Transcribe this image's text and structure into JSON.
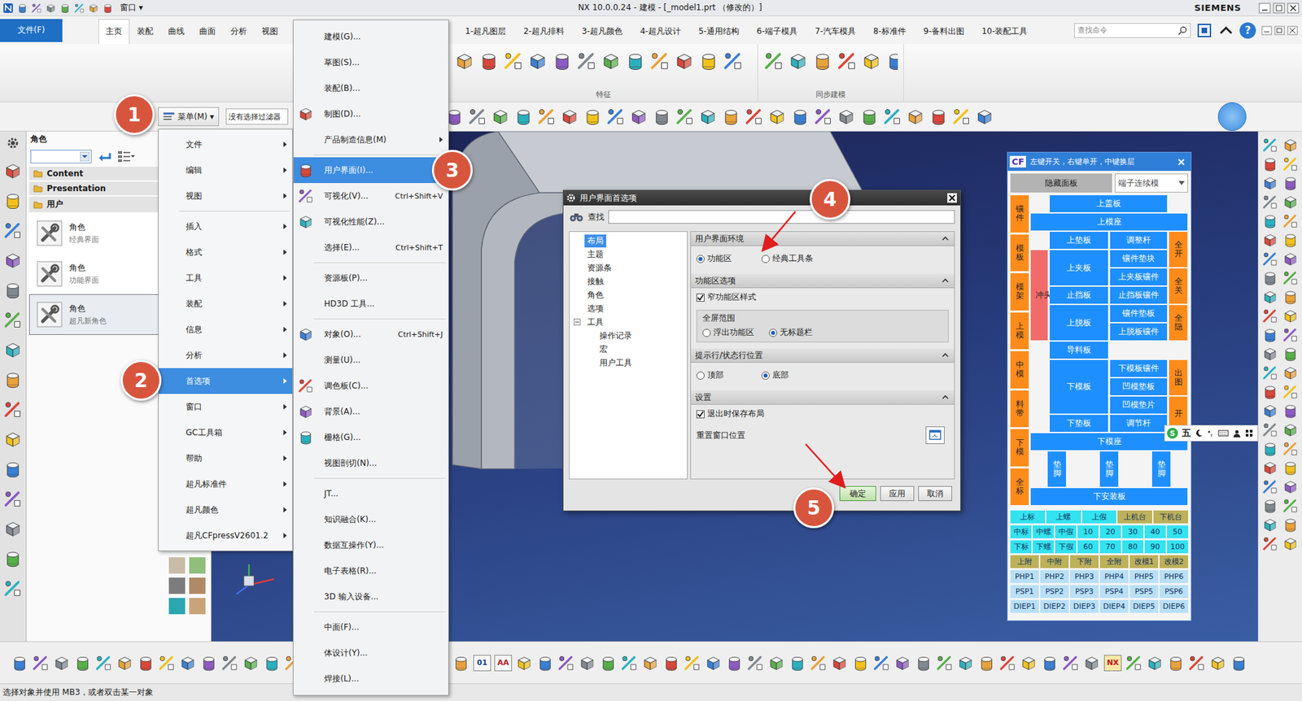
{
  "window": {
    "title": "NX 10.0.0.24 - 建模 - [_model1.prt （修改的）]",
    "brand": "SIEMENS",
    "window_menu": "窗口 ▾"
  },
  "ribbon": {
    "file_tab": "文件(F)",
    "tabs": [
      {
        "label": "主页",
        "selected": true
      },
      {
        "label": "装配",
        "selected": false
      },
      {
        "label": "曲线",
        "selected": false
      },
      {
        "label": "曲面",
        "selected": false
      },
      {
        "label": "分析",
        "selected": false
      },
      {
        "label": "视图",
        "selected": false
      }
    ],
    "custom_tabs": [
      {
        "label": "1-超凡图层",
        "selected": false
      },
      {
        "label": "2-超凡排料",
        "selected": false
      },
      {
        "label": "3-超凡颜色",
        "selected": false
      },
      {
        "label": "4-超凡设计",
        "selected": false
      },
      {
        "label": "5-通用结构",
        "selected": false
      },
      {
        "label": "6-端子模具",
        "selected": false
      },
      {
        "label": "7-汽车模具",
        "selected": false
      },
      {
        "label": "8-标准件",
        "selected": false
      },
      {
        "label": "9-备料出图",
        "selected": false
      },
      {
        "label": "10-装配工具",
        "selected": false
      }
    ],
    "search_placeholder": "查找命令",
    "help": "?",
    "groups": [
      "特征",
      "同步建模"
    ]
  },
  "toolbar": {
    "menu_button": "菜单(M) ▾",
    "selection_filter": "没有选择过滤器"
  },
  "resource_panel": {
    "title": "角色",
    "folders": [
      "Content",
      "Presentation",
      "用户"
    ],
    "roles": [
      {
        "name": "角色",
        "desc": "经典界面",
        "selected": false
      },
      {
        "name": "角色",
        "desc": "功能界面",
        "selected": false
      },
      {
        "name": "角色",
        "desc": "超凡新角色",
        "selected": true
      }
    ]
  },
  "main_menu": {
    "groups": [
      [
        {
          "label": "文件",
          "submenu": true,
          "selected": false
        },
        {
          "label": "编辑",
          "submenu": true,
          "selected": false
        },
        {
          "label": "视图",
          "submenu": true,
          "selected": false
        }
      ],
      [
        {
          "label": "插入",
          "submenu": true,
          "selected": false
        },
        {
          "label": "格式",
          "submenu": true,
          "selected": false
        },
        {
          "label": "工具",
          "submenu": true,
          "selected": false
        },
        {
          "label": "装配",
          "submenu": true,
          "selected": false
        },
        {
          "label": "信息",
          "submenu": true,
          "selected": false
        },
        {
          "label": "分析",
          "submenu": true,
          "selected": false
        },
        {
          "label": "首选项",
          "submenu": true,
          "selected": true
        },
        {
          "label": "窗口",
          "submenu": true,
          "selected": false
        },
        {
          "label": "GC工具箱",
          "submenu": true,
          "selected": false
        },
        {
          "label": "帮助",
          "submenu": true,
          "selected": false
        },
        {
          "label": "超凡标准件",
          "submenu": true,
          "selected": false
        },
        {
          "label": "超凡颜色",
          "submenu": true,
          "selected": false
        },
        {
          "label": "超凡CFpressV2601.2",
          "submenu": true,
          "selected": false
        }
      ]
    ]
  },
  "preferences_menu": {
    "groups": [
      [
        {
          "label": "建模(G)...",
          "shortcut": "",
          "icon": false,
          "submenu": false,
          "selected": false
        },
        {
          "label": "草图(S)...",
          "shortcut": "",
          "icon": false,
          "submenu": false,
          "selected": false
        },
        {
          "label": "装配(B)...",
          "shortcut": "",
          "icon": false,
          "submenu": false,
          "selected": false
        },
        {
          "label": "制图(D)...",
          "shortcut": "",
          "icon": true,
          "submenu": false,
          "selected": false
        },
        {
          "label": "产品制造信息(M)",
          "shortcut": "",
          "icon": false,
          "submenu": true,
          "selected": false
        }
      ],
      [
        {
          "label": "用户界面(I)...",
          "shortcut": "",
          "icon": true,
          "submenu": false,
          "selected": true
        },
        {
          "label": "可视化(V)...",
          "shortcut": "Ctrl+Shift+V",
          "icon": true,
          "submenu": false,
          "selected": false
        },
        {
          "label": "可视化性能(Z)...",
          "shortcut": "",
          "icon": true,
          "submenu": false,
          "selected": false
        },
        {
          "label": "选择(E)...",
          "shortcut": "Ctrl+Shift+T",
          "icon": false,
          "submenu": false,
          "selected": false
        }
      ],
      [
        {
          "label": "资源板(P)...",
          "shortcut": "",
          "icon": false,
          "submenu": false,
          "selected": false
        },
        {
          "label": "HD3D 工具...",
          "shortcut": "",
          "icon": false,
          "submenu": false,
          "selected": false
        }
      ],
      [
        {
          "label": "对象(O)...",
          "shortcut": "Ctrl+Shift+J",
          "icon": true,
          "submenu": false,
          "selected": false
        },
        {
          "label": "测量(U)...",
          "shortcut": "",
          "icon": false,
          "submenu": false,
          "selected": false
        },
        {
          "label": "调色板(C)...",
          "shortcut": "",
          "icon": true,
          "submenu": false,
          "selected": false
        },
        {
          "label": "背景(A)...",
          "shortcut": "",
          "icon": true,
          "submenu": false,
          "selected": false
        },
        {
          "label": "栅格(G)...",
          "shortcut": "",
          "icon": true,
          "submenu": false,
          "selected": false
        },
        {
          "label": "视图剖切(N)...",
          "shortcut": "",
          "icon": false,
          "submenu": false,
          "selected": false
        }
      ],
      [
        {
          "label": "JT...",
          "shortcut": "",
          "icon": false,
          "submenu": false,
          "selected": false
        },
        {
          "label": "知识融合(K)...",
          "shortcut": "",
          "icon": false,
          "submenu": false,
          "selected": false
        },
        {
          "label": "数据互操作(Y)...",
          "shortcut": "",
          "icon": false,
          "submenu": false,
          "selected": false
        },
        {
          "label": "电子表格(R)...",
          "shortcut": "",
          "icon": false,
          "submenu": false,
          "selected": false
        },
        {
          "label": "3D 输入设备...",
          "shortcut": "",
          "icon": false,
          "submenu": false,
          "selected": false
        }
      ],
      [
        {
          "label": "中面(F)...",
          "shortcut": "",
          "icon": false,
          "submenu": false,
          "selected": false
        },
        {
          "label": "体设计(Y)...",
          "shortcut": "",
          "icon": false,
          "submenu": false,
          "selected": false
        },
        {
          "label": "焊接(L)...",
          "shortcut": "",
          "icon": false,
          "submenu": false,
          "selected": false
        }
      ]
    ]
  },
  "dialog": {
    "title": "用户界面首选项",
    "search_label": "查找",
    "tree": [
      {
        "label": "布局",
        "depth": 0,
        "kind": "leaf",
        "expanded": false,
        "selected": true
      },
      {
        "label": "主题",
        "depth": 0,
        "kind": "leaf",
        "expanded": false,
        "selected": false
      },
      {
        "label": "资源条",
        "depth": 0,
        "kind": "leaf",
        "expanded": false,
        "selected": false
      },
      {
        "label": "接触",
        "depth": 0,
        "kind": "leaf",
        "expanded": false,
        "selected": false
      },
      {
        "label": "角色",
        "depth": 0,
        "kind": "leaf",
        "expanded": false,
        "selected": false
      },
      {
        "label": "选项",
        "depth": 0,
        "kind": "leaf",
        "expanded": false,
        "selected": false
      },
      {
        "label": "工具",
        "depth": 0,
        "kind": "folder",
        "expanded": true,
        "selected": false
      },
      {
        "label": "操作记录",
        "depth": 1,
        "kind": "leaf",
        "expanded": false,
        "selected": false
      },
      {
        "label": "宏",
        "depth": 1,
        "kind": "leaf",
        "expanded": false,
        "selected": false
      },
      {
        "label": "用户工具",
        "depth": 1,
        "kind": "leaf",
        "expanded": false,
        "selected": false
      }
    ],
    "sections": [
      {
        "title": "用户界面环境",
        "expanded": true,
        "rows": [
          {
            "kind": "radios",
            "options": [
              {
                "label": "功能区",
                "selected": true
              },
              {
                "label": "经典工具条",
                "selected": false
              }
            ]
          }
        ]
      },
      {
        "title": "功能区选项",
        "expanded": true,
        "rows": [
          {
            "kind": "checkbox",
            "label": "窄功能区样式",
            "checked": true
          },
          {
            "kind": "group",
            "title": "全屏范围",
            "options": [
              {
                "label": "浮出功能区",
                "selected": false
              },
              {
                "label": "无标题栏",
                "selected": true
              }
            ]
          }
        ]
      },
      {
        "title": "提示行/状态行位置",
        "expanded": true,
        "rows": [
          {
            "kind": "radios",
            "options": [
              {
                "label": "顶部",
                "selected": false
              },
              {
                "label": "底部",
                "selected": true
              }
            ]
          }
        ]
      },
      {
        "title": "设置",
        "expanded": true,
        "rows": [
          {
            "kind": "checkbox",
            "label": "退出时保存布局",
            "checked": true
          },
          {
            "kind": "button",
            "label": "重置窗口位置"
          }
        ]
      }
    ],
    "buttons": [
      {
        "label": "确定",
        "default": true
      },
      {
        "label": "应用",
        "default": false
      },
      {
        "label": "取消",
        "default": false
      }
    ]
  },
  "cf_panel": {
    "logo": "CF",
    "hint": "左键开关，右键单开，中键换层",
    "hide_button": "隐藏面板",
    "mode": "端子连续模",
    "side_tabs": [
      "镶件",
      "模板",
      "模架",
      "上模",
      "中模",
      "料带",
      "下模",
      "全标"
    ],
    "plates": [
      {
        "label": "上盖板",
        "kind": "plate",
        "color": "#1e8fff"
      },
      {
        "label": "上模座",
        "kind": "plate",
        "color": "#1e8fff"
      },
      {
        "label": "冲头",
        "kind": "punch",
        "color": "#f26b6b"
      },
      {
        "label": "上垫板",
        "kind": "plate",
        "color": "#1e8fff"
      },
      {
        "label": "调整杆",
        "kind": "plate",
        "color": "#1e8fff"
      },
      {
        "label": "上夹板",
        "kind": "plate",
        "color": "#1e8fff"
      },
      {
        "label": "镶件垫块",
        "kind": "plate",
        "color": "#1e8fff"
      },
      {
        "label": "上夹板镶件",
        "kind": "plate",
        "color": "#1e8fff"
      },
      {
        "label": "止挡板",
        "kind": "plate",
        "color": "#1e8fff"
      },
      {
        "label": "止挡板镶件",
        "kind": "plate",
        "color": "#1e8fff"
      },
      {
        "label": "上脱板",
        "kind": "plate",
        "color": "#1e8fff"
      },
      {
        "label": "镶件垫板",
        "kind": "plate",
        "color": "#1e8fff"
      },
      {
        "label": "上脱板镶件",
        "kind": "plate",
        "color": "#1e8fff"
      },
      {
        "label": "导料板",
        "kind": "plate",
        "color": "#1e8fff"
      },
      {
        "label": "下模板",
        "kind": "plate",
        "color": "#1e8fff"
      },
      {
        "label": "下模板镶件",
        "kind": "plate",
        "color": "#1e8fff"
      },
      {
        "label": "凹模垫板",
        "kind": "plate",
        "color": "#1e8fff"
      },
      {
        "label": "凹模垫片",
        "kind": "plate",
        "color": "#1e8fff"
      },
      {
        "label": "下垫板",
        "kind": "plate",
        "color": "#1e8fff"
      },
      {
        "label": "调节杆",
        "kind": "plate",
        "color": "#1e8fff"
      },
      {
        "label": "下模座",
        "kind": "plate",
        "color": "#1e8fff"
      },
      {
        "label": "下安装板",
        "kind": "plate",
        "color": "#1e8fff"
      }
    ],
    "feet": [
      "垫脚",
      "垫脚",
      "垫脚"
    ],
    "toggles": [
      "全开",
      "全关",
      "全隐",
      "出图",
      "开"
    ],
    "grid_rows": [
      [
        {
          "label": "上标",
          "color": "#33e3ef"
        },
        {
          "label": "上螺",
          "color": "#33e3ef"
        },
        {
          "label": "上假",
          "color": "#33e3ef"
        },
        {
          "label": "上机台",
          "color": "#bdb15a"
        },
        {
          "label": "下机台",
          "color": "#bdb15a"
        }
      ],
      [
        {
          "label": "中标",
          "color": "#33e3ef"
        },
        {
          "label": "中螺",
          "color": "#33e3ef"
        },
        {
          "label": "中假",
          "color": "#33e3ef"
        },
        {
          "label": "10",
          "color": "#33e3ef"
        },
        {
          "label": "20",
          "color": "#33e3ef"
        },
        {
          "label": "30",
          "color": "#33e3ef"
        },
        {
          "label": "40",
          "color": "#33e3ef"
        },
        {
          "label": "50",
          "color": "#33e3ef"
        }
      ],
      [
        {
          "label": "下标",
          "color": "#33e3ef"
        },
        {
          "label": "下螺",
          "color": "#33e3ef"
        },
        {
          "label": "下假",
          "color": "#33e3ef"
        },
        {
          "label": "60",
          "color": "#33e3ef"
        },
        {
          "label": "70",
          "color": "#33e3ef"
        },
        {
          "label": "80",
          "color": "#33e3ef"
        },
        {
          "label": "90",
          "color": "#33e3ef"
        },
        {
          "label": "100",
          "color": "#33e3ef"
        }
      ],
      [
        {
          "label": "上附",
          "color": "#bdb15a"
        },
        {
          "label": "中附",
          "color": "#bdb15a"
        },
        {
          "label": "下附",
          "color": "#bdb15a"
        },
        {
          "label": "全附",
          "color": "#bdb15a"
        },
        {
          "label": "改模1",
          "color": "#bdb15a"
        },
        {
          "label": "改模2",
          "color": "#bdb15a"
        }
      ],
      [
        {
          "label": "PHP1",
          "color": "#b9e0f7"
        },
        {
          "label": "PHP2",
          "color": "#b9e0f7"
        },
        {
          "label": "PHP3",
          "color": "#b9e0f7"
        },
        {
          "label": "PHP4",
          "color": "#b9e0f7"
        },
        {
          "label": "PHP5",
          "color": "#b9e0f7"
        },
        {
          "label": "PHP6",
          "color": "#b9e0f7"
        }
      ],
      [
        {
          "label": "PSP1",
          "color": "#b9e0f7"
        },
        {
          "label": "PSP2",
          "color": "#b9e0f7"
        },
        {
          "label": "PSP3",
          "color": "#b9e0f7"
        },
        {
          "label": "PSP4",
          "color": "#b9e0f7"
        },
        {
          "label": "PSP5",
          "color": "#b9e0f7"
        },
        {
          "label": "PSP6",
          "color": "#b9e0f7"
        }
      ],
      [
        {
          "label": "DIEP1",
          "color": "#b9e0f7"
        },
        {
          "label": "DIEP2",
          "color": "#b9e0f7"
        },
        {
          "label": "DIEP3",
          "color": "#b9e0f7"
        },
        {
          "label": "DIEP4",
          "color": "#b9e0f7"
        },
        {
          "label": "DIEP5",
          "color": "#b9e0f7"
        },
        {
          "label": "DIEP6",
          "color": "#b9e0f7"
        }
      ]
    ]
  },
  "ime_bar": {
    "logo": "S",
    "mode": "五"
  },
  "bottom_toolbar": {
    "icon_labels": [
      "01",
      "AA",
      "NX"
    ]
  },
  "status_bar": {
    "text": "选择对象并使用 MB3，或者双击某一对象"
  },
  "steps": [
    "1",
    "2",
    "3",
    "4",
    "5"
  ]
}
